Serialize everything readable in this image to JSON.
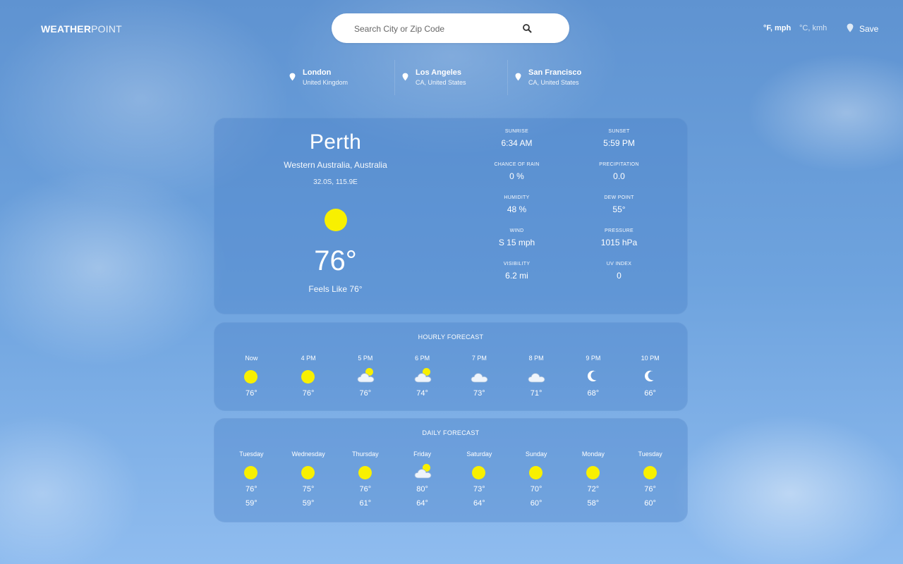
{
  "header": {
    "logo_bold": "WEATHER",
    "logo_light": "POINT",
    "search_placeholder": "Search City or Zip Code",
    "unit_imperial": "°F, mph",
    "unit_metric": "°C, kmh",
    "save_label": "Save"
  },
  "saved_locations": [
    {
      "city": "London",
      "region": "United Kingdom"
    },
    {
      "city": "Los Angeles",
      "region": "CA, United States"
    },
    {
      "city": "San Francisco",
      "region": "CA, United States"
    }
  ],
  "current": {
    "city": "Perth",
    "region": "Western Australia, Australia",
    "coords": "32.0S, 115.9E",
    "condition_icon": "sun-icon",
    "temp": "76°",
    "feels_like": "Feels Like 76°"
  },
  "stats": [
    {
      "label": "SUNRISE",
      "value": "6:34 AM"
    },
    {
      "label": "SUNSET",
      "value": "5:59 PM"
    },
    {
      "label": "CHANCE OF RAIN",
      "value": "0 %"
    },
    {
      "label": "PRECIPITATION",
      "value": "0.0"
    },
    {
      "label": "HUMIDITY",
      "value": "48 %"
    },
    {
      "label": "DEW POINT",
      "value": "55°"
    },
    {
      "label": "WIND",
      "value": "S 15 mph"
    },
    {
      "label": "PRESSURE",
      "value": "1015 hPa"
    },
    {
      "label": "VISIBILITY",
      "value": "6.2 mi"
    },
    {
      "label": "UV INDEX",
      "value": "0"
    }
  ],
  "hourly": {
    "title": "HOURLY FORECAST",
    "items": [
      {
        "time": "Now",
        "icon": "sun-icon",
        "temp": "76°"
      },
      {
        "time": "4 PM",
        "icon": "sun-icon",
        "temp": "76°"
      },
      {
        "time": "5 PM",
        "icon": "partly-cloudy-icon",
        "temp": "76°"
      },
      {
        "time": "6 PM",
        "icon": "partly-cloudy-icon",
        "temp": "74°"
      },
      {
        "time": "7 PM",
        "icon": "cloud-icon",
        "temp": "73°"
      },
      {
        "time": "8 PM",
        "icon": "cloud-icon",
        "temp": "71°"
      },
      {
        "time": "9 PM",
        "icon": "moon-icon",
        "temp": "68°"
      },
      {
        "time": "10 PM",
        "icon": "moon-icon",
        "temp": "66°"
      }
    ]
  },
  "daily": {
    "title": "DAILY FORECAST",
    "items": [
      {
        "day": "Tuesday",
        "icon": "sun-icon",
        "high": "76°",
        "low": "59°"
      },
      {
        "day": "Wednesday",
        "icon": "sun-icon",
        "high": "75°",
        "low": "59°"
      },
      {
        "day": "Thursday",
        "icon": "sun-icon",
        "high": "76°",
        "low": "61°"
      },
      {
        "day": "Friday",
        "icon": "partly-cloudy-icon",
        "high": "80°",
        "low": "64°"
      },
      {
        "day": "Saturday",
        "icon": "sun-icon",
        "high": "73°",
        "low": "64°"
      },
      {
        "day": "Sunday",
        "icon": "sun-icon",
        "high": "70°",
        "low": "60°"
      },
      {
        "day": "Monday",
        "icon": "sun-icon",
        "high": "72°",
        "low": "58°"
      },
      {
        "day": "Tuesday",
        "icon": "sun-icon",
        "high": "76°",
        "low": "60°"
      }
    ]
  },
  "colors": {
    "sun": "#f8f000",
    "card": "rgba(74,130,200,0.38)"
  }
}
